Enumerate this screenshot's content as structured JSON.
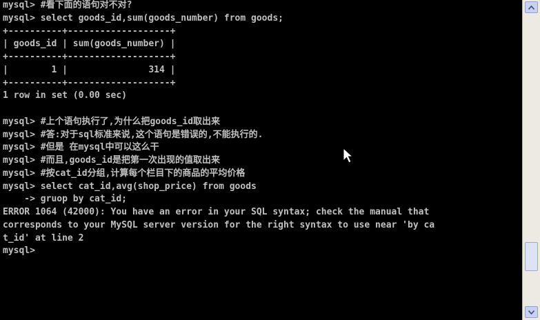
{
  "console": {
    "lines": [
      "mysql> #看下面的语句对不对?",
      "mysql> select goods_id,sum(goods_number) from goods;",
      "+----------+-------------------+",
      "| goods_id | sum(goods_number) |",
      "+----------+-------------------+",
      "|        1 |               314 |",
      "+----------+-------------------+",
      "1 row in set (0.00 sec)",
      "",
      "mysql> #上个语句执行了,为什么把goods_id取出来",
      "mysql> #答:对于sql标准来说,这个语句是错误的,不能执行的.",
      "mysql> #但是 在mysql中可以这么干",
      "mysql> #而且,goods_id是把第一次出现的值取出来",
      "mysql> #按cat_id分组,计算每个栏目下的商品的平均价格",
      "mysql> select cat_id,avg(shop_price) from goods",
      "    -> gruop by cat_id;",
      "ERROR 1064 (42000): You have an error in your SQL syntax; check the manual that",
      "corresponds to your MySQL server version for the right syntax to use near 'by ca",
      "t_id' at line 2",
      "mysql>"
    ]
  },
  "scrollbar": {
    "up_icon": "arrow-up-icon",
    "down_icon": "arrow-down-icon",
    "position": 0.87
  },
  "cursor": {
    "icon": "mouse-pointer-icon"
  },
  "colors": {
    "background": "#000000",
    "text": "#c0c0c0",
    "scrollbar": "#eceae3"
  }
}
